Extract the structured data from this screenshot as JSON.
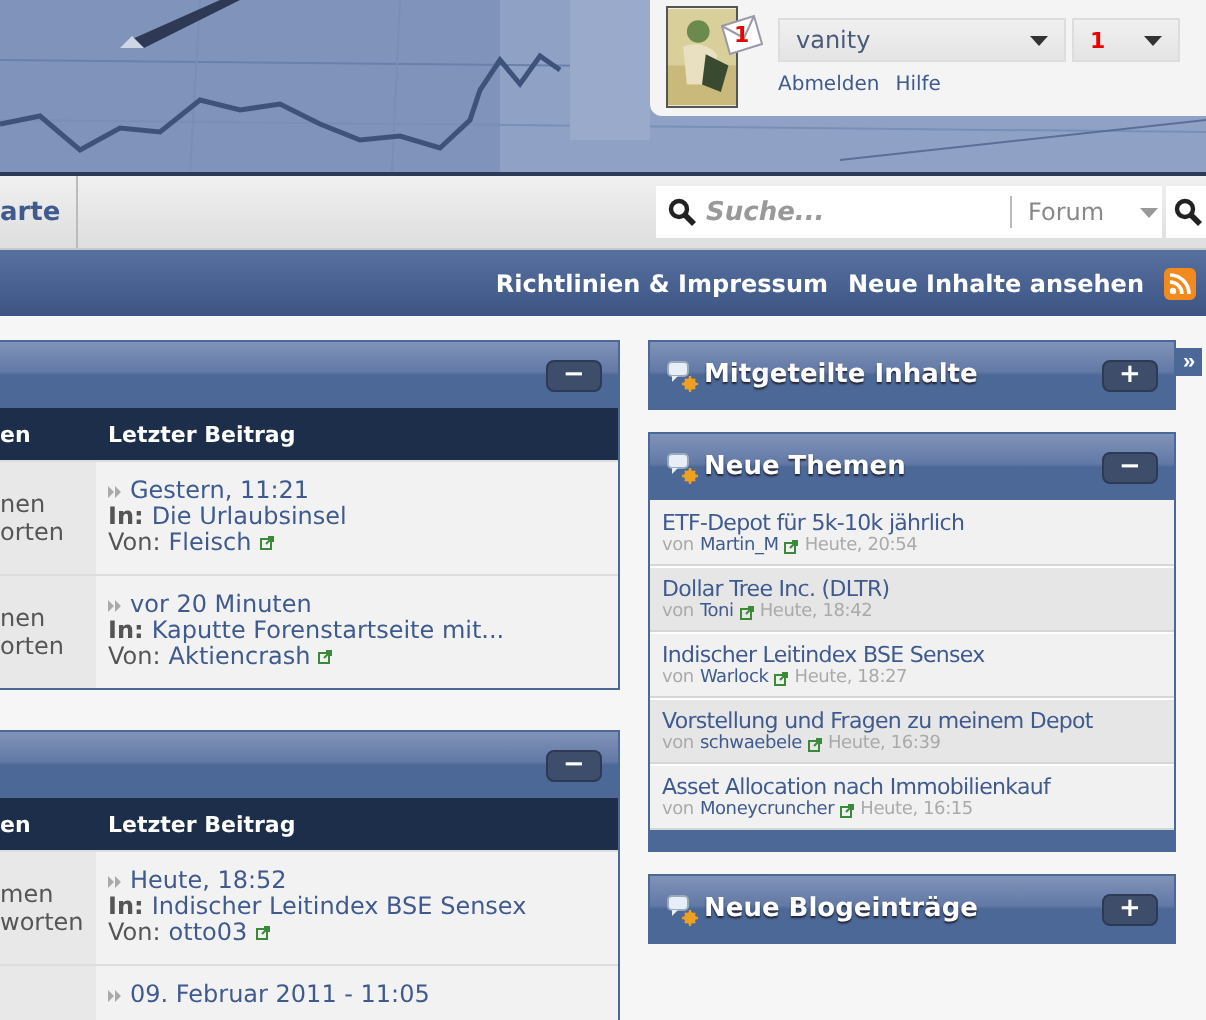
{
  "user_panel": {
    "message_count": "1",
    "username": "vanity",
    "notifications": "1",
    "links": [
      "Abmelden",
      "Hilfe"
    ]
  },
  "navbar": {
    "tabs": [
      {
        "label": "arte"
      }
    ],
    "search": {
      "placeholder": "Suche...",
      "scope": "Forum"
    }
  },
  "subnav": {
    "links": [
      "Richtlinien & Impressum",
      "Neue Inhalte ansehen"
    ]
  },
  "forum_sections": [
    {
      "toggle": "−",
      "columns": [
        "en",
        "Letzter Beitrag"
      ],
      "rows": [
        {
          "column_1": [
            "nen",
            "orten"
          ],
          "last_post": {
            "time": "Gestern, 11:21",
            "in_label": "In:",
            "thread": "Die Urlaubsinsel",
            "by_label": "Von:",
            "author": "Fleisch"
          }
        },
        {
          "column_1": [
            "nen",
            "orten"
          ],
          "last_post": {
            "time": "vor 20 Minuten",
            "in_label": "In:",
            "thread": "Kaputte Forenstartseite mit...",
            "by_label": "Von:",
            "author": "Aktiencrash"
          }
        }
      ]
    },
    {
      "toggle": "−",
      "columns": [
        "en",
        "Letzter Beitrag"
      ],
      "rows": [
        {
          "column_1": [
            "men",
            "worten"
          ],
          "last_post": {
            "time": "Heute, 18:52",
            "in_label": "In:",
            "thread": "Indischer Leitindex BSE Sensex",
            "by_label": "Von:",
            "author": "otto03"
          }
        },
        {
          "column_1": [],
          "last_post": {
            "time": "09. Februar 2011 - 11:05"
          }
        }
      ]
    }
  ],
  "sidebar_toggle": "»",
  "sidebar": [
    {
      "title": "Mitgeteilte Inhalte",
      "toggle": "+"
    },
    {
      "title": "Neue Themen",
      "toggle": "−",
      "threads": [
        {
          "title": "ETF-Depot für 5k-10k jährlich",
          "by_label": "von",
          "author": "Martin_M",
          "time": "Heute, 20:54"
        },
        {
          "title": "Dollar Tree Inc. (DLTR)",
          "by_label": "von",
          "author": "Toni",
          "time": "Heute, 18:42"
        },
        {
          "title": "Indischer Leitindex BSE Sensex",
          "by_label": "von",
          "author": "Warlock",
          "time": "Heute, 18:27"
        },
        {
          "title": "Vorstellung und Fragen zu meinem Depot",
          "by_label": "von",
          "author": "schwaebele",
          "time": "Heute, 16:39"
        },
        {
          "title": "Asset Allocation nach Immobilienkauf",
          "by_label": "von",
          "author": "Moneycruncher",
          "time": "Heute, 16:15"
        }
      ]
    },
    {
      "title": "Neue Blogeinträge",
      "toggle": "+"
    }
  ]
}
